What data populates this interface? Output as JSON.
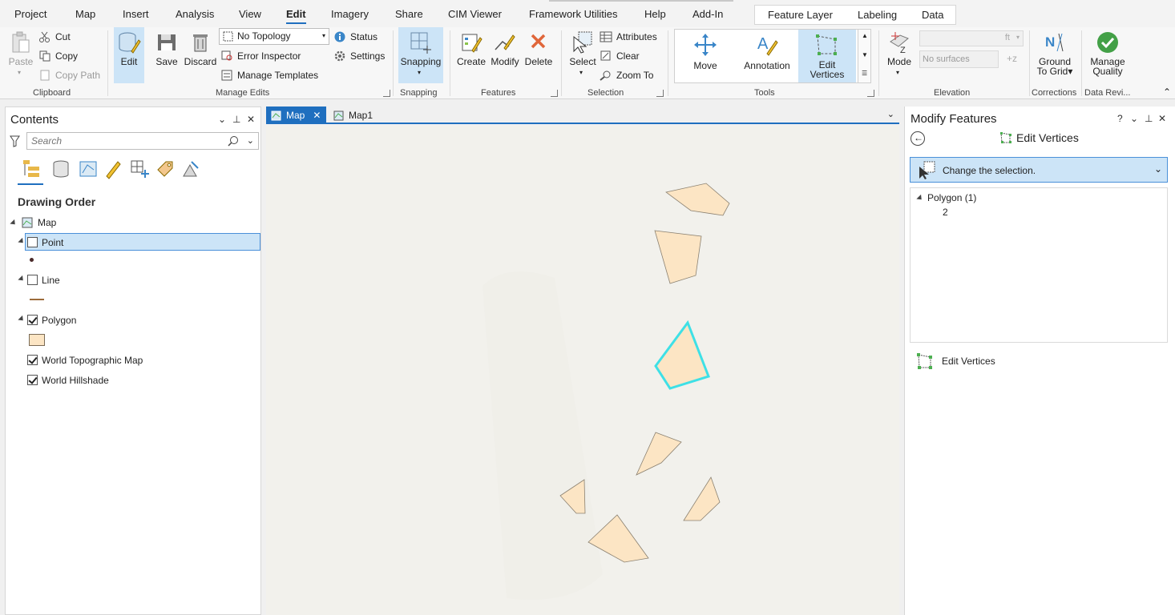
{
  "menu": {
    "items": [
      "Project",
      "Map",
      "Insert",
      "Analysis",
      "View",
      "Edit",
      "Imagery",
      "Share",
      "CIM Viewer",
      "Framework Utilities",
      "Help",
      "Add-In"
    ],
    "active": "Edit",
    "context_tabs": [
      "Feature Layer",
      "Labeling",
      "Data"
    ]
  },
  "ribbon": {
    "clipboard": {
      "paste": "Paste",
      "cut": "Cut",
      "copy": "Copy",
      "copy_path": "Copy Path",
      "label": "Clipboard"
    },
    "manage_edits": {
      "edit": "Edit",
      "save": "Save",
      "discard": "Discard",
      "topology": "No Topology",
      "error_inspector": "Error Inspector",
      "manage_templates": "Manage Templates",
      "status": "Status",
      "settings": "Settings",
      "label": "Manage Edits"
    },
    "snapping": {
      "snapping": "Snapping",
      "label": "Snapping"
    },
    "features": {
      "create": "Create",
      "modify": "Modify",
      "delete": "Delete",
      "label": "Features"
    },
    "selection": {
      "select": "Select",
      "attributes": "Attributes",
      "clear": "Clear",
      "zoom_to": "Zoom To",
      "label": "Selection"
    },
    "tools": {
      "move": "Move",
      "annotation": "Annotation",
      "edit_vertices_1": "Edit",
      "edit_vertices_2": "Vertices",
      "label": "Tools"
    },
    "elevation": {
      "mode": "Mode",
      "unit": "ft",
      "surface": "No surfaces",
      "label": "Elevation"
    },
    "corrections": {
      "ground_1": "Ground",
      "ground_2": "To Grid",
      "label": "Corrections"
    },
    "data_reviewer": {
      "manage_1": "Manage",
      "manage_2": "Quality",
      "label": "Data Revi..."
    }
  },
  "contents": {
    "title": "Contents",
    "search_placeholder": "Search",
    "heading": "Drawing Order",
    "map": "Map",
    "layers": [
      {
        "name": "Point",
        "checked": false
      },
      {
        "name": "Line",
        "checked": false
      },
      {
        "name": "Polygon",
        "checked": true
      },
      {
        "name": "World Topographic Map",
        "checked": true
      },
      {
        "name": "World Hillshade",
        "checked": true
      }
    ]
  },
  "map_tabs": [
    "Map",
    "Map1"
  ],
  "modify": {
    "title": "Modify Features",
    "help": "?",
    "subtitle": "Edit Vertices",
    "selection_hint": "Change the selection.",
    "tree_layer": "Polygon (1)",
    "tree_feature": "2",
    "tool_row": "Edit Vertices"
  },
  "colors": {
    "accent": "#1f6fbf",
    "selected_bg": "#cce4f7",
    "polygon_fill": "#fce5c4",
    "selection_outline": "#3ee0e6",
    "map_bg": "#f2f1ec"
  }
}
